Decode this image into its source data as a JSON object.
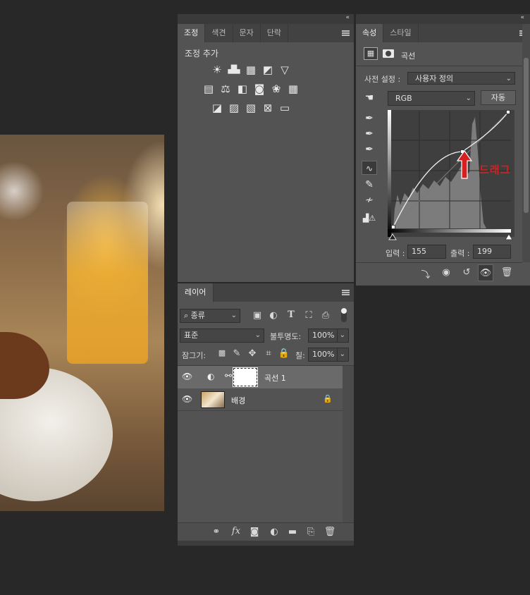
{
  "adjustments_panel": {
    "tabs": [
      "조정",
      "색견",
      "문자",
      "단락"
    ],
    "active_tab": 0,
    "section_title": "조정 추가",
    "row1_icons": [
      "brightness-icon",
      "levels-icon",
      "curves-icon",
      "exposure-icon",
      "vibrance-icon"
    ],
    "row2_icons": [
      "hue-saturation-icon",
      "color-balance-icon",
      "black-white-icon",
      "photo-filter-icon",
      "channel-mixer-icon",
      "color-lookup-icon"
    ],
    "row3_icons": [
      "invert-icon",
      "posterize-icon",
      "threshold-icon",
      "selective-color-icon",
      "gradient-map-icon"
    ]
  },
  "properties_panel": {
    "tabs": [
      "속성",
      "스타일"
    ],
    "active_tab": 0,
    "type_label": "곡선",
    "preset_label": "사전 설정 :",
    "preset_value": "사용자 정의",
    "channel_value": "RGB",
    "auto_button": "자동",
    "annotation": "드래그",
    "input_label": "입력 :",
    "input_value": "155",
    "output_label": "출력 :",
    "output_value": "199",
    "accent_red": "#d62020"
  },
  "layers_panel": {
    "tab": "레이어",
    "filter_kind": "종류",
    "blend_mode": "표준",
    "opacity_label": "불투명도:",
    "opacity_value": "100%",
    "lock_label": "잠그기:",
    "fill_label": "칠:",
    "fill_value": "100%",
    "layers": [
      {
        "name": "곡선 1",
        "type": "adjustment",
        "selected": true
      },
      {
        "name": "배경",
        "type": "image",
        "locked": true
      }
    ]
  }
}
